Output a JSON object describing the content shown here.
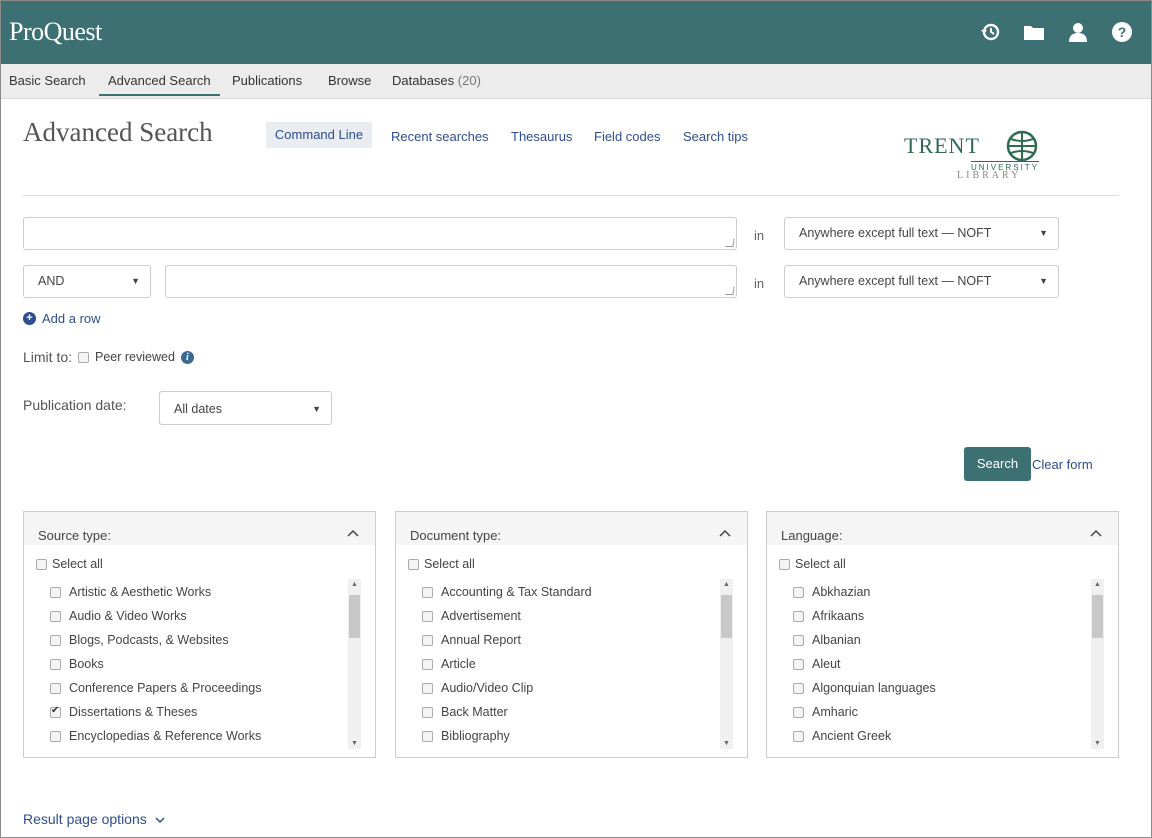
{
  "header": {
    "logo": "ProQuest"
  },
  "nav": {
    "basic": "Basic Search",
    "advanced": "Advanced Search",
    "publications": "Publications",
    "browse": "Browse",
    "databases": "Databases",
    "databases_count": "(20)"
  },
  "page": {
    "title": "Advanced Search"
  },
  "subnav": {
    "command_line": "Command Line",
    "recent": "Recent searches",
    "thesaurus": "Thesaurus",
    "field_codes": "Field codes",
    "tips": "Search tips"
  },
  "branding": {
    "trent": "TRENT",
    "university": "UNIVERSITY",
    "library": "LIBRARY"
  },
  "search_rows": {
    "in_label": "in",
    "row1_field": "Anywhere except full text — NOFT",
    "row2_operator": "AND",
    "row2_field": "Anywhere except full text — NOFT"
  },
  "add_row": "Add a row",
  "limit": {
    "label": "Limit to:",
    "peer": "Peer reviewed"
  },
  "pubdate": {
    "label": "Publication date:",
    "value": "All dates"
  },
  "actions": {
    "search": "Search",
    "clear": "Clear form"
  },
  "panels": {
    "source": {
      "title": "Source type:",
      "select_all": "Select all",
      "items": [
        "Artistic & Aesthetic Works",
        "Audio & Video Works",
        "Blogs, Podcasts, & Websites",
        "Books",
        "Conference Papers & Proceedings",
        "Dissertations & Theses",
        "Encyclopedias & Reference Works"
      ]
    },
    "doctype": {
      "title": "Document type:",
      "select_all": "Select all",
      "items": [
        "Accounting & Tax Standard",
        "Advertisement",
        "Annual Report",
        "Article",
        "Audio/Video Clip",
        "Back Matter",
        "Bibliography"
      ]
    },
    "language": {
      "title": "Language:",
      "select_all": "Select all",
      "items": [
        "Abkhazian",
        "Afrikaans",
        "Albanian",
        "Aleut",
        "Algonquian languages",
        "Amharic",
        "Ancient Greek"
      ]
    }
  },
  "result_options": "Result page options",
  "colors": {
    "brand": "#3d7073",
    "link": "#2f4d8f"
  },
  "icons": [
    "history-icon",
    "folder-icon",
    "user-icon",
    "help-icon"
  ]
}
